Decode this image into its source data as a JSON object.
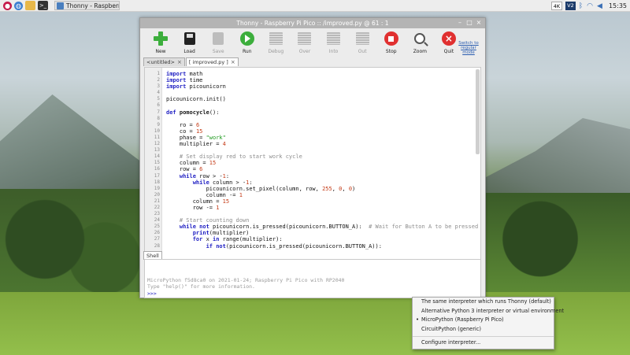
{
  "taskbar": {
    "task_label": "Thonny - Raspberry ...",
    "keyboard": "4K",
    "vnc": "V2",
    "clock": "15:35"
  },
  "window": {
    "title": "Thonny - Raspberry Pi Pico :: /improved.py @ 61 : 1",
    "controls": [
      "–",
      "□",
      "×"
    ]
  },
  "toolbar": {
    "new": "New",
    "load": "Load",
    "save": "Save",
    "run": "Run",
    "debug": "Debug",
    "over": "Over",
    "into": "Into",
    "out": "Out",
    "stop": "Stop",
    "zoom": "Zoom",
    "quit": "Quit",
    "switch_line1": "Switch to",
    "switch_line2": "regular",
    "switch_line3": "mode"
  },
  "tabs": [
    {
      "label": "<untitled>",
      "close": "×"
    },
    {
      "label": "[ improved.py ]",
      "close": "×"
    }
  ],
  "editor": {
    "lines": [
      {
        "n": "1",
        "html": "<span class='kw'>import</span> math"
      },
      {
        "n": "2",
        "html": "<span class='kw'>import</span> time"
      },
      {
        "n": "3",
        "html": "<span class='kw'>import</span> picounicorn"
      },
      {
        "n": "4",
        "html": ""
      },
      {
        "n": "5",
        "html": "picounicorn.init()"
      },
      {
        "n": "6",
        "html": ""
      },
      {
        "n": "7",
        "html": "<span class='kw'>def</span> <span class='fn'>pomocycle</span>():"
      },
      {
        "n": "8",
        "html": ""
      },
      {
        "n": "9",
        "html": "    ro = <span class='nm'>6</span>"
      },
      {
        "n": "10",
        "html": "    co = <span class='nm'>15</span>"
      },
      {
        "n": "11",
        "html": "    phase = <span class='st'>\"work\"</span>"
      },
      {
        "n": "12",
        "html": "    multiplier = <span class='nm'>4</span>"
      },
      {
        "n": "13",
        "html": ""
      },
      {
        "n": "14",
        "html": "    <span class='cm'># Set display red to start work cycle</span>"
      },
      {
        "n": "15",
        "html": "    column = <span class='nm'>15</span>"
      },
      {
        "n": "16",
        "html": "    row = <span class='nm'>6</span>"
      },
      {
        "n": "17",
        "html": "    <span class='kw'>while</span> row > -<span class='nm'>1</span>:"
      },
      {
        "n": "18",
        "html": "        <span class='kw'>while</span> column > -<span class='nm'>1</span>:"
      },
      {
        "n": "19",
        "html": "            picounicorn.set_pixel(column, row, <span class='nm'>255</span>, <span class='nm'>0</span>, <span class='nm'>0</span>)"
      },
      {
        "n": "20",
        "html": "            column -= <span class='nm'>1</span>"
      },
      {
        "n": "21",
        "html": "        column = <span class='nm'>15</span>"
      },
      {
        "n": "22",
        "html": "        row -= <span class='nm'>1</span>"
      },
      {
        "n": "23",
        "html": ""
      },
      {
        "n": "24",
        "html": "    <span class='cm'># Start counting down</span>"
      },
      {
        "n": "25",
        "html": "    <span class='kw'>while not</span> picounicorn.is_pressed(picounicorn.BUTTON_A):  <span class='cm'># Wait for Button A to be pressed</span>"
      },
      {
        "n": "26",
        "html": "        <span class='kw'>print</span>(multiplier)"
      },
      {
        "n": "27",
        "html": "        <span class='kw'>for</span> x <span class='kw'>in</span> range(multiplier):"
      },
      {
        "n": "28",
        "html": "            <span class='kw'>if not</span>(picounicorn.is_pressed(picounicorn.BUTTON_A)):"
      }
    ]
  },
  "shell": {
    "tab_label": "Shell",
    "line1": "MicroPython f5d8ca0 on 2021-01-24; Raspberry Pi Pico with RP2040",
    "line2": "Type \"help()\" for more information.",
    "prompt": ">>>"
  },
  "interpreter_menu": {
    "items": [
      {
        "label": "The same interpreter which runs Thonny (default)",
        "selected": false
      },
      {
        "label": "Alternative Python 3 interpreter or virtual environment",
        "selected": false
      },
      {
        "label": "MicroPython (Raspberry Pi Pico)",
        "selected": true
      },
      {
        "label": "CircuitPython (generic)",
        "selected": false
      }
    ],
    "configure": "Configure interpreter..."
  }
}
